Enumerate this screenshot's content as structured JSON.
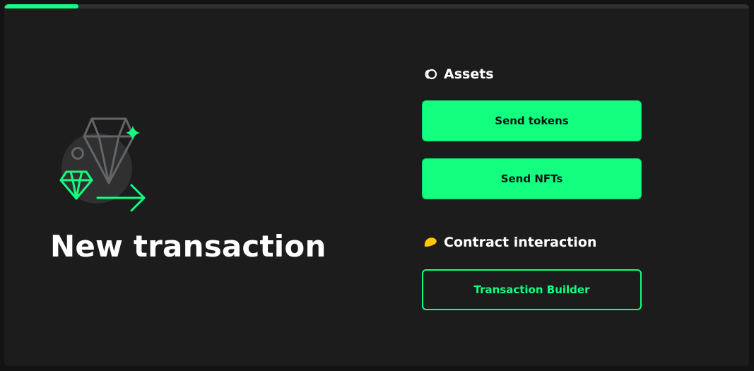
{
  "progress": {
    "percent": 10
  },
  "hero": {
    "title": "New transaction",
    "illustration_icon": "diamond-transfer-icon"
  },
  "assets": {
    "heading": "Assets",
    "icon": "assets-icon",
    "send_tokens_label": "Send tokens",
    "send_nfts_label": "Send NFTs"
  },
  "contract": {
    "heading": "Contract interaction",
    "icon": "contract-icon",
    "builder_label": "Transaction Builder"
  },
  "colors": {
    "accent": "#12ff80",
    "background": "#1c1c1c",
    "page": "#121312",
    "icon_gray": "#636669",
    "contract_icon": "#ffc700"
  }
}
